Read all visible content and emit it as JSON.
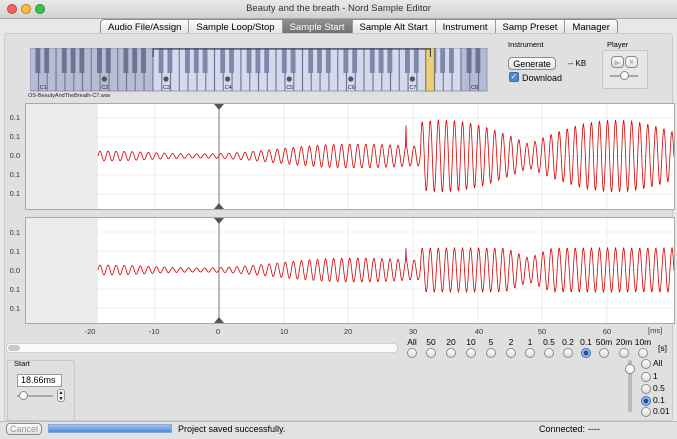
{
  "window": {
    "title": "Beauty and the breath - Nord Sample Editor"
  },
  "tabs": [
    "Audio File/Assign",
    "Sample Loop/Stop",
    "Sample Start",
    "Sample Alt Start",
    "Instrument",
    "Samp Preset",
    "Manager"
  ],
  "active_tab": "Sample Start",
  "keyboard": {
    "octave_labels": [
      "C1",
      "C2",
      "C3",
      "C4",
      "C5",
      "C6",
      "C7",
      "C8"
    ],
    "file_label": "OS-BeautyAndTheBreath-C7.wav"
  },
  "instrument": {
    "label": "Instrument",
    "generate_label": "Generate",
    "size_text": "-- KB",
    "download_label": "Download",
    "download_checked": true
  },
  "player": {
    "label": "Player"
  },
  "waveform": {
    "y_ticks": [
      "0.1",
      "0.1",
      "0.0",
      "0.1",
      "0.1"
    ],
    "x_ticks": [
      "-20",
      "-10",
      "0",
      "10",
      "20",
      "30",
      "40",
      "50",
      "60"
    ],
    "x_unit": "[ms]"
  },
  "zoom": {
    "options": [
      "All",
      "50",
      "20",
      "10",
      "5",
      "2",
      "1",
      "0.5",
      "0.2",
      "0.1",
      "50m",
      "20m",
      "10m"
    ],
    "selected": "0.1",
    "unit": "[s]"
  },
  "amp_zoom": {
    "options": [
      "All",
      "1",
      "0.5",
      "0.1",
      "0.01"
    ],
    "selected": "0.1"
  },
  "start": {
    "label": "Start",
    "value": "18.66ms"
  },
  "status": {
    "cancel_label": "Cancel",
    "message": "Project saved successfully.",
    "connected_label": "Connected:",
    "connected_value": "----"
  }
}
